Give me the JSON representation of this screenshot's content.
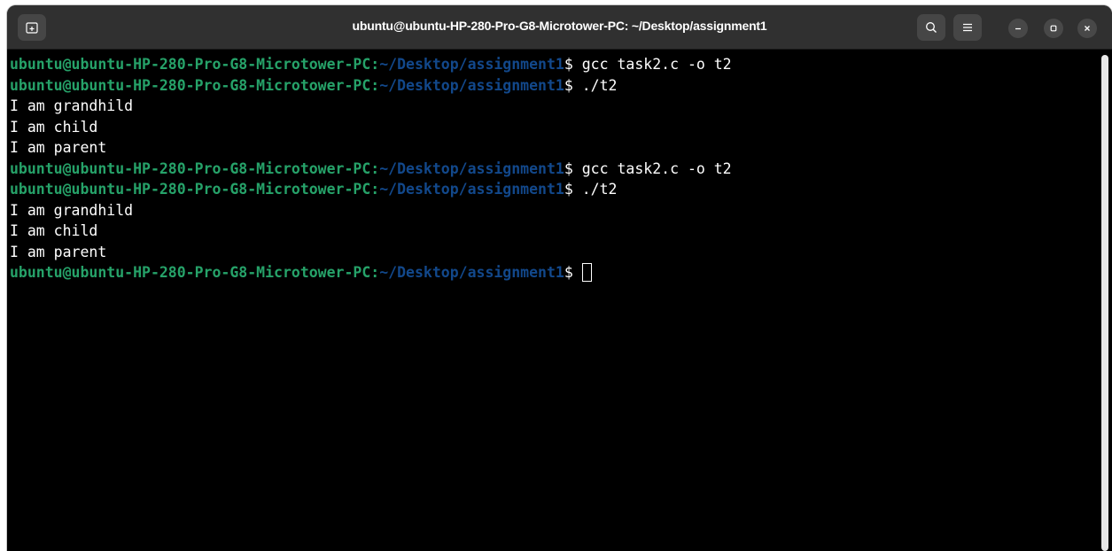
{
  "window": {
    "title": "ubuntu@ubuntu-HP-280-Pro-G8-Microtower-PC: ~/Desktop/assignment1"
  },
  "prompt": {
    "user_host": "ubuntu@ubuntu-HP-280-Pro-G8-Microtower-PC",
    "separator": ":",
    "path": "~/Desktop/assignment1",
    "symbol": "$ "
  },
  "lines": [
    {
      "kind": "prompt",
      "command": "gcc task2.c -o t2"
    },
    {
      "kind": "prompt",
      "command": "./t2"
    },
    {
      "kind": "output",
      "text": "I am grandhild"
    },
    {
      "kind": "output",
      "text": "I am child"
    },
    {
      "kind": "output",
      "text": "I am parent"
    },
    {
      "kind": "prompt",
      "command": "gcc task2.c -o t2"
    },
    {
      "kind": "prompt",
      "command": "./t2"
    },
    {
      "kind": "output",
      "text": "I am grandhild"
    },
    {
      "kind": "output",
      "text": "I am child"
    },
    {
      "kind": "output",
      "text": "I am parent"
    },
    {
      "kind": "prompt",
      "command": ""
    }
  ],
  "icons": {
    "new_tab": "new-tab-icon",
    "search": "search-icon",
    "menu": "hamburger-menu-icon",
    "minimize": "minimize-icon",
    "maximize": "maximize-icon",
    "close": "close-icon"
  },
  "colors": {
    "prompt_user": "#26a269",
    "prompt_path": "#12488b",
    "text": "#ffffff",
    "background": "#000000",
    "titlebar": "#303030"
  }
}
